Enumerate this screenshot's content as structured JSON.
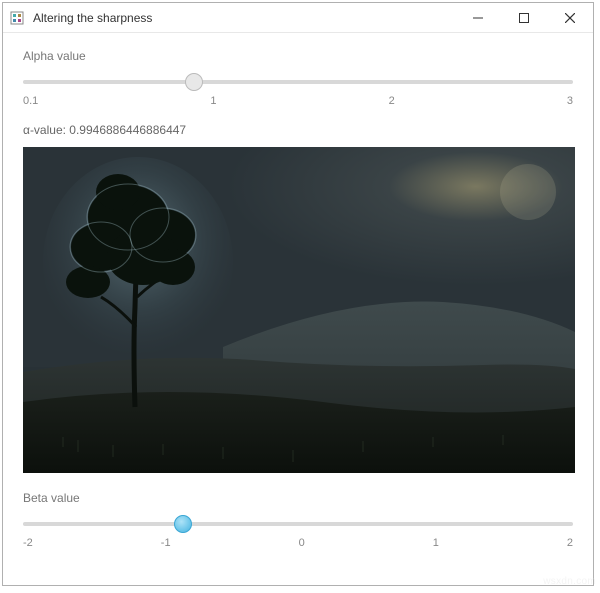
{
  "window": {
    "title": "Altering the sharpness"
  },
  "alpha": {
    "label": "Alpha value",
    "min": "0.1",
    "t1": "1",
    "t2": "2",
    "max": "3",
    "position_pct": 31.0,
    "readout_prefix": "α-value: ",
    "readout_value": "0.9946886446886447"
  },
  "beta": {
    "label": "Beta value",
    "min": "-2",
    "t1": "-1",
    "t2": "0",
    "t3": "1",
    "max": "2",
    "position_pct": 29.0
  },
  "watermark": "wsxdn.com"
}
